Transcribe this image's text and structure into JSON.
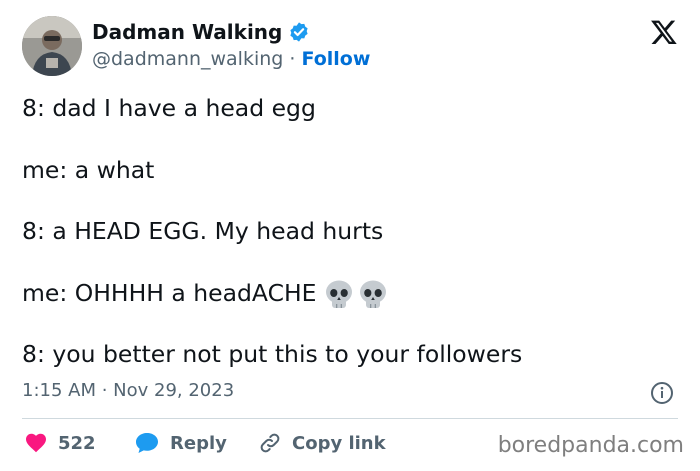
{
  "author": {
    "display_name": "Dadman Walking",
    "handle": "@dadmann_walking",
    "separator": " · ",
    "follow_label": "Follow"
  },
  "tweet": {
    "lines": [
      "8: dad I have a head egg",
      "me: a what",
      "8: a HEAD EGG. My head hurts",
      "me: OHHHH a headACHE",
      "8: you better not put this to your followers"
    ],
    "emoji": [
      "skull-emoji",
      "skull-emoji"
    ],
    "timestamp": "1:15 AM · Nov 29, 2023"
  },
  "actions": {
    "like_count": "522",
    "reply_label": "Reply",
    "copy_label": "Copy link"
  },
  "watermark": "boredpanda.com",
  "icons": {
    "verified": "verified-badge-icon",
    "x_logo": "x-logo-icon",
    "info": "info-icon",
    "heart": "heart-icon",
    "reply": "reply-bubble-icon",
    "link": "link-icon"
  },
  "colors": {
    "verified_blue": "#1d9bf0",
    "follow_blue": "#006fd6",
    "like_pink": "#f91880",
    "text": "#0f1419",
    "muted": "#536471"
  }
}
